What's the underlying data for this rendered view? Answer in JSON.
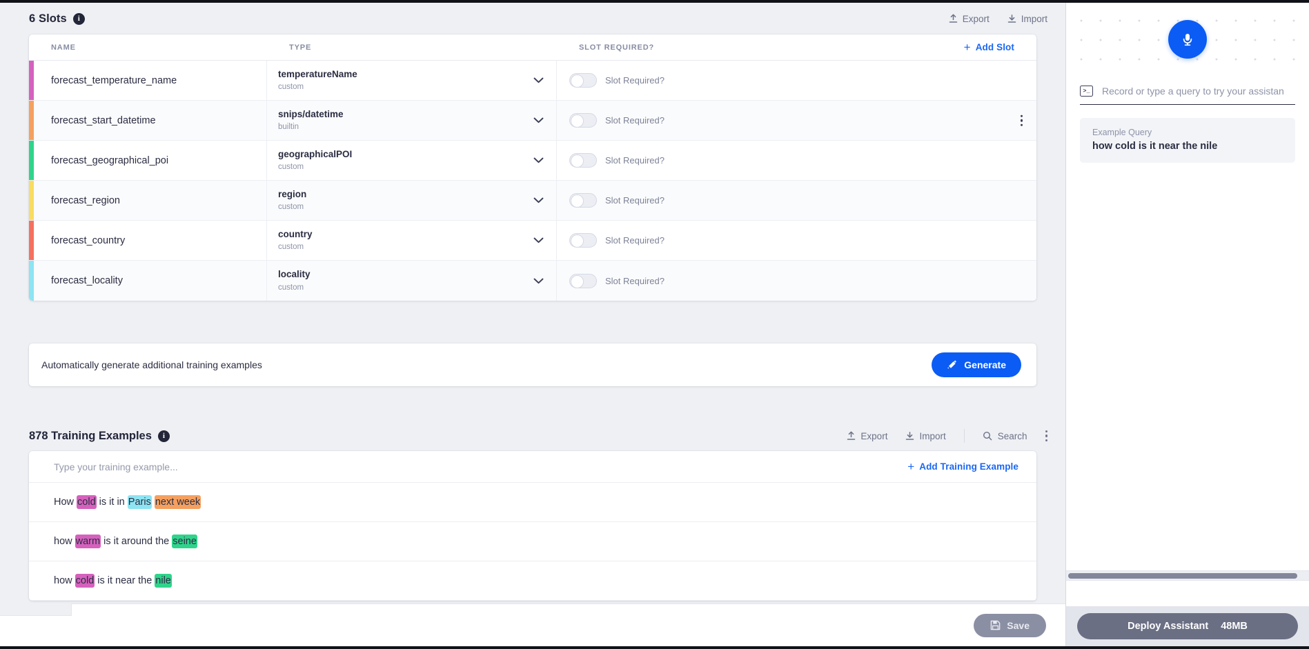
{
  "slots_section": {
    "title": "6 Slots",
    "info_icon": "info-icon",
    "export_label": "Export",
    "import_label": "Import",
    "columns": {
      "name": "NAME",
      "type": "TYPE",
      "required": "SLOT REQUIRED?"
    },
    "add_slot_label": "Add Slot",
    "plus": "+",
    "toggle_label": "Slot Required?",
    "rows": [
      {
        "name": "forecast_temperature_name",
        "type": "temperatureName",
        "kind": "custom",
        "color": "#d561bd",
        "required": false,
        "menu": false
      },
      {
        "name": "forecast_start_datetime",
        "type": "snips/datetime",
        "kind": "builtin",
        "color": "#f5a05f",
        "required": false,
        "menu": true
      },
      {
        "name": "forecast_geographical_poi",
        "type": "geographicalPOI",
        "kind": "custom",
        "color": "#2fd48b",
        "required": false,
        "menu": false
      },
      {
        "name": "forecast_region",
        "type": "region",
        "kind": "custom",
        "color": "#f9dc60",
        "required": false,
        "menu": false
      },
      {
        "name": "forecast_country",
        "type": "country",
        "kind": "custom",
        "color": "#f5705f",
        "required": false,
        "menu": false
      },
      {
        "name": "forecast_locality",
        "type": "locality",
        "kind": "custom",
        "color": "#8de4f2",
        "required": false,
        "menu": false
      }
    ]
  },
  "generate_section": {
    "text": "Automatically generate additional training examples",
    "button_label": "Generate",
    "button_icon": "magic-wand-icon",
    "button_color": "#0b5cf5"
  },
  "training_section": {
    "title": "878 Training Examples",
    "count": 878,
    "info_icon": "info-icon",
    "export_label": "Export",
    "import_label": "Import",
    "search_label": "Search",
    "overflow_icon": "more-vertical-icon",
    "input_placeholder": "Type your training example...",
    "add_example_label": "Add Training Example",
    "plus": "+",
    "examples": [
      {
        "tokens": [
          {
            "text": "How ",
            "color": null
          },
          {
            "text": "cold",
            "color": "#d561bd"
          },
          {
            "text": " is it in ",
            "color": null
          },
          {
            "text": "Paris",
            "color": "#8de4f2"
          },
          {
            "text": " ",
            "color": null
          },
          {
            "text": "next week",
            "color": "#f5a05f"
          }
        ]
      },
      {
        "tokens": [
          {
            "text": "how ",
            "color": null
          },
          {
            "text": "warm",
            "color": "#d561bd"
          },
          {
            "text": " is it around the ",
            "color": null
          },
          {
            "text": "seine",
            "color": "#2fd48b"
          }
        ]
      },
      {
        "tokens": [
          {
            "text": "how ",
            "color": null
          },
          {
            "text": "cold",
            "color": "#d561bd"
          },
          {
            "text": " is it near the ",
            "color": null
          },
          {
            "text": "nile",
            "color": "#2fd48b"
          }
        ]
      }
    ]
  },
  "footer": {
    "save_label": "Save",
    "save_icon": "floppy-disk-icon",
    "save_enabled": false
  },
  "assistant_panel": {
    "mic_icon": "microphone-icon",
    "mic_color": "#0b5cf5",
    "terminal_icon": "terminal-icon",
    "query_placeholder": "Record or type a query to try your assistan",
    "example_query_label": "Example Query",
    "example_query_text": "how cold is it near the nile",
    "deploy_label": "Deploy Assistant",
    "deploy_size": "48MB"
  }
}
